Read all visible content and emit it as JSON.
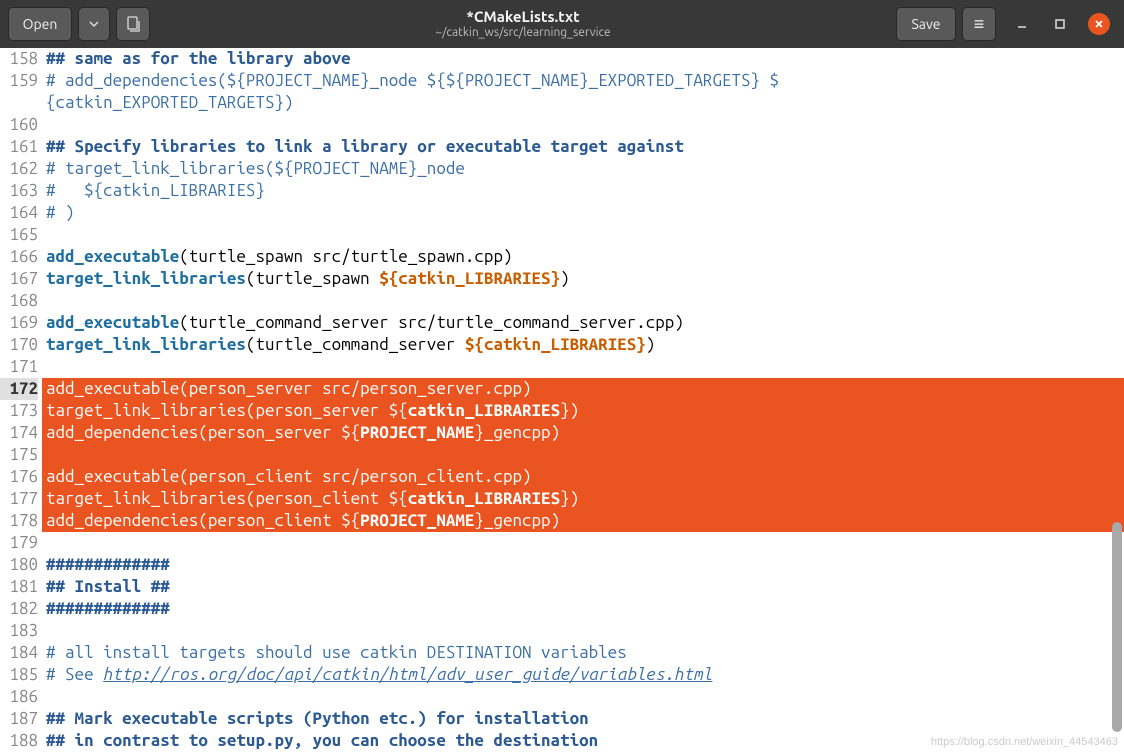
{
  "header": {
    "open_label": "Open",
    "save_label": "Save",
    "title": "*CMakeLists.txt",
    "subtitle": "~/catkin_ws/src/learning_service"
  },
  "line_start": 158,
  "lines": [
    {
      "n": 158,
      "sel": false,
      "segs": [
        {
          "t": "## same as for the library above",
          "cls": "c-comment-dark"
        }
      ]
    },
    {
      "n": 159,
      "sel": false,
      "segs": [
        {
          "t": "# add_dependencies(${PROJECT_NAME}_node ${${PROJECT_NAME}_EXPORTED_TARGETS} ${catkin_EXPORTED_TARGETS})",
          "cls": "c-comment"
        }
      ],
      "wrap": true
    },
    {
      "n": 160,
      "sel": false,
      "segs": [
        {
          "t": "",
          "cls": ""
        }
      ]
    },
    {
      "n": 161,
      "sel": false,
      "segs": [
        {
          "t": "## Specify libraries to link a library or executable target against",
          "cls": "c-comment-dark"
        }
      ]
    },
    {
      "n": 162,
      "sel": false,
      "segs": [
        {
          "t": "# target_link_libraries(${PROJECT_NAME}_node",
          "cls": "c-comment"
        }
      ]
    },
    {
      "n": 163,
      "sel": false,
      "segs": [
        {
          "t": "#   ${catkin_LIBRARIES}",
          "cls": "c-comment"
        }
      ]
    },
    {
      "n": 164,
      "sel": false,
      "segs": [
        {
          "t": "# )",
          "cls": "c-comment"
        }
      ]
    },
    {
      "n": 165,
      "sel": false,
      "segs": [
        {
          "t": "",
          "cls": ""
        }
      ]
    },
    {
      "n": 166,
      "sel": false,
      "segs": [
        {
          "t": "add_executable",
          "cls": "c-func"
        },
        {
          "t": "(turtle_spawn src/turtle_spawn.cpp)",
          "cls": ""
        }
      ]
    },
    {
      "n": 167,
      "sel": false,
      "segs": [
        {
          "t": "target_link_libraries",
          "cls": "c-func"
        },
        {
          "t": "(turtle_spawn ",
          "cls": ""
        },
        {
          "t": "${",
          "cls": "c-var"
        },
        {
          "t": "catkin_LIBRARIES",
          "cls": "c-var c-bvar"
        },
        {
          "t": "}",
          "cls": "c-var"
        },
        {
          "t": ")",
          "cls": ""
        }
      ]
    },
    {
      "n": 168,
      "sel": false,
      "segs": [
        {
          "t": "",
          "cls": ""
        }
      ]
    },
    {
      "n": 169,
      "sel": false,
      "segs": [
        {
          "t": "add_executable",
          "cls": "c-func"
        },
        {
          "t": "(turtle_command_server src/turtle_command_server.cpp)",
          "cls": ""
        }
      ]
    },
    {
      "n": 170,
      "sel": false,
      "segs": [
        {
          "t": "target_link_libraries",
          "cls": "c-func"
        },
        {
          "t": "(turtle_command_server ",
          "cls": ""
        },
        {
          "t": "${",
          "cls": "c-var"
        },
        {
          "t": "catkin_LIBRARIES",
          "cls": "c-var c-bvar"
        },
        {
          "t": "}",
          "cls": "c-var"
        },
        {
          "t": ")",
          "cls": ""
        }
      ]
    },
    {
      "n": 171,
      "sel": false,
      "segs": [
        {
          "t": "",
          "cls": ""
        }
      ]
    },
    {
      "n": 172,
      "sel": true,
      "segs": [
        {
          "t": "add_executable(person_server src/person_server.cpp)",
          "cls": ""
        }
      ]
    },
    {
      "n": 173,
      "sel": true,
      "segs": [
        {
          "t": "target_link_libraries(person_server ${",
          "cls": ""
        },
        {
          "t": "catkin_LIBRARIES",
          "cls": "c-bvar"
        },
        {
          "t": "})",
          "cls": ""
        }
      ]
    },
    {
      "n": 174,
      "sel": true,
      "segs": [
        {
          "t": "add_dependencies(person_server ${",
          "cls": ""
        },
        {
          "t": "PROJECT_NAME",
          "cls": "c-bvar"
        },
        {
          "t": "}_gencpp)",
          "cls": ""
        }
      ]
    },
    {
      "n": 175,
      "sel": true,
      "segs": [
        {
          "t": "",
          "cls": ""
        }
      ]
    },
    {
      "n": 176,
      "sel": true,
      "segs": [
        {
          "t": "add_executable(person_client src/person_client.cpp)",
          "cls": ""
        }
      ]
    },
    {
      "n": 177,
      "sel": true,
      "segs": [
        {
          "t": "target_link_libraries(person_client ${",
          "cls": ""
        },
        {
          "t": "catkin_LIBRARIES",
          "cls": "c-bvar"
        },
        {
          "t": "})",
          "cls": ""
        }
      ]
    },
    {
      "n": 178,
      "sel": true,
      "segs": [
        {
          "t": "add_dependencies(person_client ${",
          "cls": ""
        },
        {
          "t": "PROJECT_NAME",
          "cls": "c-bvar"
        },
        {
          "t": "}_gencpp)",
          "cls": ""
        }
      ],
      "sel_partial": true
    },
    {
      "n": 179,
      "sel": false,
      "segs": [
        {
          "t": "",
          "cls": ""
        }
      ]
    },
    {
      "n": 180,
      "sel": false,
      "segs": [
        {
          "t": "#############",
          "cls": "c-comment-dark"
        }
      ]
    },
    {
      "n": 181,
      "sel": false,
      "segs": [
        {
          "t": "## Install ##",
          "cls": "c-comment-dark"
        }
      ]
    },
    {
      "n": 182,
      "sel": false,
      "segs": [
        {
          "t": "#############",
          "cls": "c-comment-dark"
        }
      ]
    },
    {
      "n": 183,
      "sel": false,
      "segs": [
        {
          "t": "",
          "cls": ""
        }
      ]
    },
    {
      "n": 184,
      "sel": false,
      "segs": [
        {
          "t": "# all install targets should use catkin DESTINATION variables",
          "cls": "c-comment"
        }
      ]
    },
    {
      "n": 185,
      "sel": false,
      "segs": [
        {
          "t": "# See ",
          "cls": "c-comment"
        },
        {
          "t": "http://ros.org/doc/api/catkin/html/adv_user_guide/variables.html",
          "cls": "c-link"
        }
      ]
    },
    {
      "n": 186,
      "sel": false,
      "segs": [
        {
          "t": "",
          "cls": ""
        }
      ]
    },
    {
      "n": 187,
      "sel": false,
      "segs": [
        {
          "t": "## Mark executable scripts (Python etc.) for installation",
          "cls": "c-comment-dark"
        }
      ]
    },
    {
      "n": 188,
      "sel": false,
      "segs": [
        {
          "t": "## in contrast to setup.py, you can choose the destination",
          "cls": "c-comment-dark"
        }
      ],
      "cut": true
    }
  ],
  "watermark": "https://blog.csdn.net/weixin_44543463",
  "active_line": 172
}
